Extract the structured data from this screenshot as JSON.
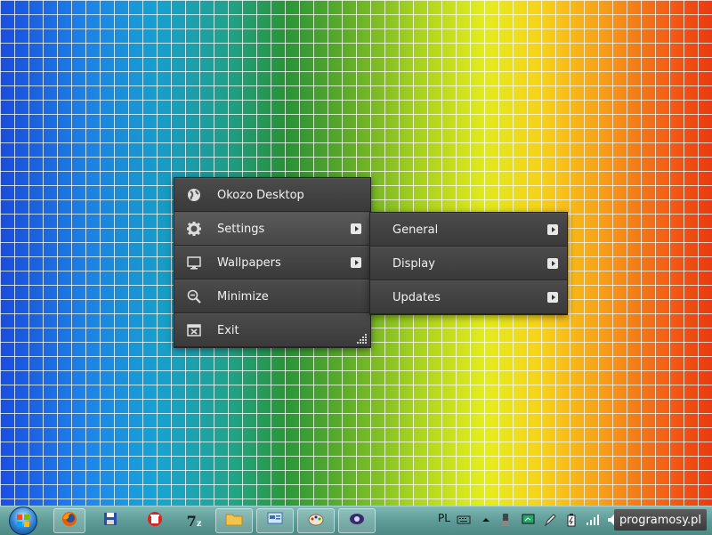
{
  "menu": {
    "items": [
      {
        "label": "Okozo Desktop",
        "icon": "globe-icon",
        "has_submenu": false
      },
      {
        "label": "Settings",
        "icon": "gear-icon",
        "has_submenu": true
      },
      {
        "label": "Wallpapers",
        "icon": "monitor-icon",
        "has_submenu": true
      },
      {
        "label": "Minimize",
        "icon": "zoom-out-icon",
        "has_submenu": false
      },
      {
        "label": "Exit",
        "icon": "close-window-icon",
        "has_submenu": false
      }
    ]
  },
  "settings_submenu": {
    "items": [
      {
        "label": "General"
      },
      {
        "label": "Display"
      },
      {
        "label": "Updates"
      }
    ]
  },
  "taskbar": {
    "pinned": [
      "firefox-icon",
      "save-icon",
      "uninstall-icon",
      "7zip-icon",
      "explorer-folder-icon",
      "control-panel-icon",
      "paint-icon",
      "webcam-icon"
    ],
    "language": "PL",
    "tray_icons": [
      "keyboard-icon",
      "show-hidden-icons",
      "usb-icon",
      "monitor-status-icon",
      "pen-icon",
      "battery-icon",
      "signal-icon",
      "volume-icon"
    ]
  },
  "watermark": {
    "text": "programosy.pl"
  },
  "colors": {
    "menu_bg": "#3c3c3c",
    "menu_text": "#f2f2f2",
    "taskbar": "#5f9c97"
  }
}
